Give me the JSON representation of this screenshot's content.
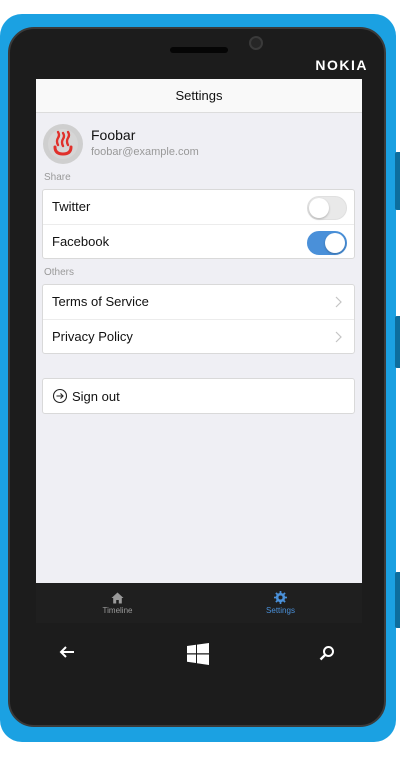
{
  "device": {
    "brand": "NOKIA"
  },
  "nav_bar": {
    "title": "Settings"
  },
  "profile": {
    "name": "Foobar",
    "email": "foobar@example.com"
  },
  "sections": {
    "share": {
      "header": "Share",
      "items": [
        {
          "label": "Twitter",
          "enabled": false
        },
        {
          "label": "Facebook",
          "enabled": true
        }
      ]
    },
    "others": {
      "header": "Others",
      "items": [
        {
          "label": "Terms of Service"
        },
        {
          "label": "Privacy Policy"
        }
      ]
    }
  },
  "sign_out": {
    "label": "Sign out"
  },
  "tab_bar": {
    "tabs": [
      {
        "label": "Timeline",
        "icon": "home-icon",
        "active": false
      },
      {
        "label": "Settings",
        "icon": "gear-icon",
        "active": true
      }
    ]
  },
  "hardware_nav": {
    "back_icon": "back-arrow-icon",
    "start_icon": "windows-logo-icon",
    "search_icon": "search-icon"
  },
  "colors": {
    "phone_body": "#1ba1e2",
    "accent": "#4a90d9",
    "background": "#efeff4",
    "tab_bar": "#1f1f1f"
  }
}
